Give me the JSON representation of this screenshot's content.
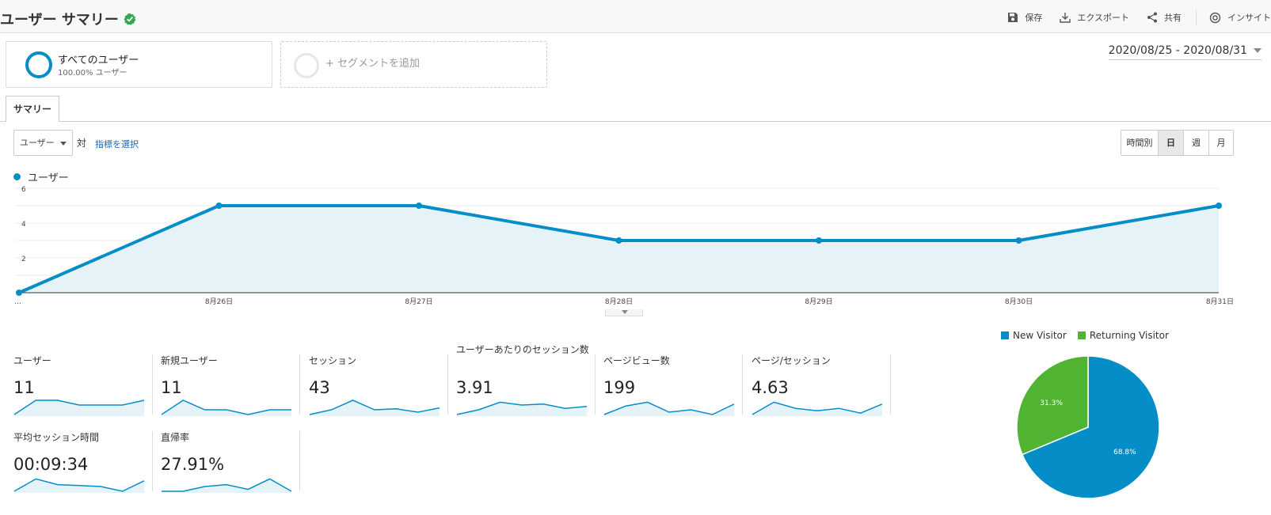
{
  "header": {
    "title": "ユーザー サマリー",
    "actions": {
      "save": "保存",
      "export": "エクスポート",
      "share": "共有",
      "insight": "インサイト"
    }
  },
  "segments": {
    "all_users": {
      "name": "すべてのユーザー",
      "percentage": "100.00% ユーザー"
    },
    "add_segment": "+ セグメントを追加"
  },
  "date_range": "2020/08/25 - 2020/08/31",
  "tabs": {
    "summary": "サマリー"
  },
  "metric_selector": {
    "selected": "ユーザー",
    "vs": "対",
    "select_metric": "指標を選択"
  },
  "granularity": {
    "hourly": "時間別",
    "day": "日",
    "week": "週",
    "month": "月",
    "selected": "日"
  },
  "colors": {
    "accent": "#058dc7",
    "accent_fill": "#e5f2f8",
    "returning": "#50b432",
    "verified": "#34a853",
    "link": "#1a67b8"
  },
  "chart_data": {
    "type": "area",
    "series": [
      {
        "name": "ユーザー",
        "values": [
          0,
          5,
          5,
          3,
          3,
          3,
          5
        ]
      }
    ],
    "categories": [
      "…",
      "8月26日",
      "8月27日",
      "8月28日",
      "8月29日",
      "8月30日",
      "8月31日"
    ],
    "y_ticks": [
      "2",
      "4",
      "6"
    ],
    "ylim": [
      0,
      6
    ],
    "grid": true,
    "legend": "top-left"
  },
  "scorecards": [
    {
      "label": "ユーザー",
      "value": "11",
      "trend": [
        0,
        3,
        3,
        2,
        2,
        2,
        3
      ]
    },
    {
      "label": "新規ユーザー",
      "value": "11",
      "trend": [
        0,
        3,
        1,
        1,
        0,
        1,
        1
      ]
    },
    {
      "label": "セッション",
      "value": "43",
      "trend": [
        0,
        1,
        3,
        1,
        1.2,
        0.5,
        1.4
      ]
    },
    {
      "label": "ユーザーあたりのセッション数",
      "value": "3.91",
      "trend": [
        0,
        1,
        2.6,
        2,
        2.2,
        1.3,
        1.7
      ]
    },
    {
      "label": "ページビュー数",
      "value": "199",
      "trend": [
        0,
        1.8,
        2.6,
        0.5,
        1,
        0,
        2.2
      ]
    },
    {
      "label": "ページ/セッション",
      "value": "4.63",
      "trend": [
        0,
        2.6,
        1.3,
        0.8,
        1.3,
        0.3,
        2.2
      ]
    },
    {
      "label": "平均セッション時間",
      "value": "00:09:34",
      "trend": [
        0,
        2.6,
        1.4,
        1.2,
        1,
        0,
        2.2
      ]
    },
    {
      "label": "直帰率",
      "value": "27.91%",
      "trend": [
        0,
        0,
        1,
        1.4,
        0.4,
        2.6,
        0
      ]
    }
  ],
  "visitor_pie": {
    "type": "pie",
    "slices": [
      {
        "name": "New Visitor",
        "value": 68.8,
        "label": "68.8%",
        "color": "#058dc7"
      },
      {
        "name": "Returning Visitor",
        "value": 31.3,
        "label": "31.3%",
        "color": "#50b432"
      }
    ]
  }
}
